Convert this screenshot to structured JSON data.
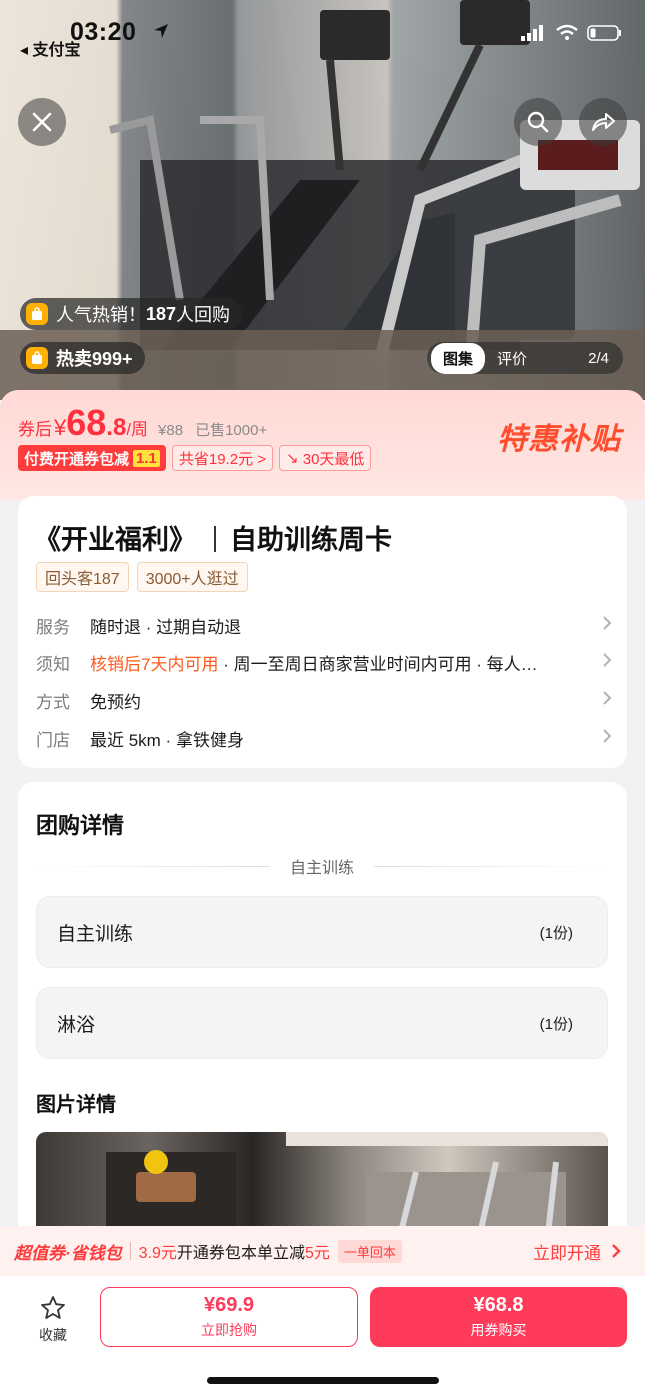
{
  "status_bar": {
    "time": "03:20",
    "back_app": "支付宝"
  },
  "hero": {
    "popular_text_prefix": "人气热销！",
    "popular_count": "187",
    "popular_text_suffix": "人回购",
    "hot_sale": "热卖999+",
    "gallery_tab_active": "图集",
    "gallery_tab_review": "评价",
    "gallery_count": "2/4"
  },
  "price": {
    "after_label": "券后",
    "currency": "¥",
    "integer": "68",
    "decimal": ".8",
    "unit": "/周",
    "original": "¥88",
    "sold": "已售1000+",
    "subsidy": "特惠补贴",
    "tag_paid": "付费开通券包减",
    "tag_paid_amount": "1.1",
    "tag_save": "共省19.2元 >",
    "tag_lowest": "30天最低"
  },
  "product": {
    "title_left": "《开业福利》",
    "title_right": "自助训练周卡",
    "chips": [
      "回头客187",
      "3000+人逛过"
    ],
    "info": [
      {
        "key": "服务",
        "value": "随时退 · 过期自动退"
      },
      {
        "key": "须知",
        "highlight": "核销后7天内可用",
        "value": " · 周一至周日商家营业时间内可用 · 每人…"
      },
      {
        "key": "方式",
        "value": "免预约"
      },
      {
        "key": "门店",
        "value": "最近 5km · 拿铁健身"
      }
    ]
  },
  "details": {
    "title": "团购详情",
    "divider_label": "自主训练",
    "items": [
      {
        "name": "自主训练",
        "qty": "(1份)"
      },
      {
        "name": "淋浴",
        "qty": "(1份)"
      }
    ],
    "images_title": "图片详情"
  },
  "promo": {
    "brand": "超值券·省钱包",
    "price_hl": "3.9元",
    "text1": "开通券包",
    "text2": " 本单立减",
    "amount_hl": "5元",
    "small_tag": "一单回本",
    "action": "立即开通"
  },
  "bottom": {
    "fav_label": "收藏",
    "buy_now_price": "¥69.9",
    "buy_now_label": "立即抢购",
    "coupon_price": "¥68.8",
    "coupon_label": "用券购买"
  },
  "colors": {
    "accent": "#ff3b5a",
    "price_red": "#ff2f3e",
    "highlight_orange": "#ff5a1f"
  },
  "icons": [
    "close-icon",
    "search-icon",
    "share-icon",
    "star-icon",
    "chevron-right-icon",
    "location-arrow-icon",
    "wifi-icon",
    "battery-icon",
    "signal-icon"
  ]
}
